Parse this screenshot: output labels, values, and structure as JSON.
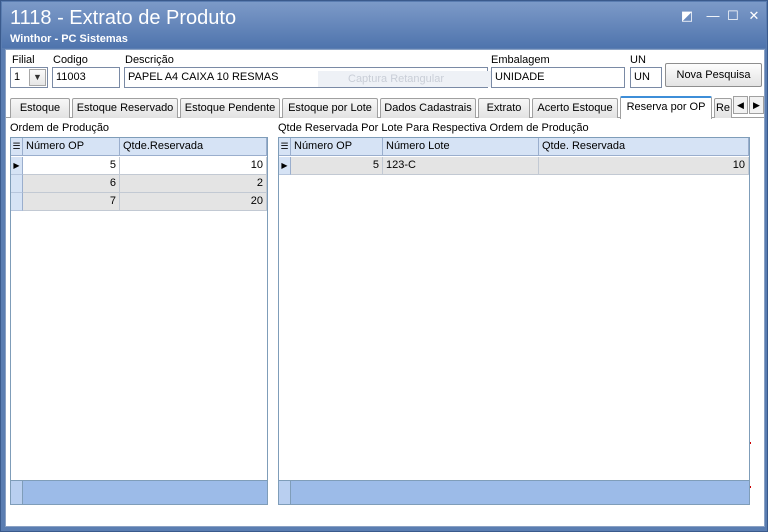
{
  "window": {
    "title": "1118 - Extrato de Produto",
    "subtitle": "Winthor - PC Sistemas"
  },
  "header": {
    "filial_label": "Filial",
    "filial_value": "1",
    "codigo_label": "Codigo",
    "codigo_value": "11003",
    "descricao_label": "Descrição",
    "descricao_value": "PAPEL A4 CAIXA 10 RESMAS",
    "embalagem_label": "Embalagem",
    "embalagem_value": "UNIDADE",
    "un_label": "UN",
    "un_value": "UN",
    "nova_pesquisa_label": "Nova Pesquisa",
    "ghost_overlay": "Captura Retangular"
  },
  "tabs": [
    {
      "label": "Estoque"
    },
    {
      "label": "Estoque Reservado"
    },
    {
      "label": "Estoque Pendente"
    },
    {
      "label": "Estoque por Lote"
    },
    {
      "label": "Dados Cadastrais"
    },
    {
      "label": "Extrato"
    },
    {
      "label": "Acerto Estoque"
    },
    {
      "label": "Reserva por OP"
    },
    {
      "label": "Re"
    }
  ],
  "active_tab": "Reserva por OP",
  "left_grid": {
    "section_label": "Ordem de Produção",
    "columns": [
      "Número OP",
      "Qtde.Reservada"
    ],
    "rows": [
      {
        "op": "5",
        "qtde": "10"
      },
      {
        "op": "6",
        "qtde": "2"
      },
      {
        "op": "7",
        "qtde": "20"
      }
    ]
  },
  "right_grid": {
    "section_label": "Qtde Reservada Por Lote Para Respectiva Ordem de Produção",
    "columns": [
      "Número OP",
      "Número Lote",
      "Qtde. Reservada"
    ],
    "rows": [
      {
        "op": "5",
        "lote": "123-C",
        "qtde": "10"
      }
    ]
  },
  "colors": {
    "title_bar": "#5a7db1",
    "grid_header": "#d6e3f5",
    "grid_footer": "#9cbbe8",
    "active_tab_accent": "#3e8ed8"
  }
}
